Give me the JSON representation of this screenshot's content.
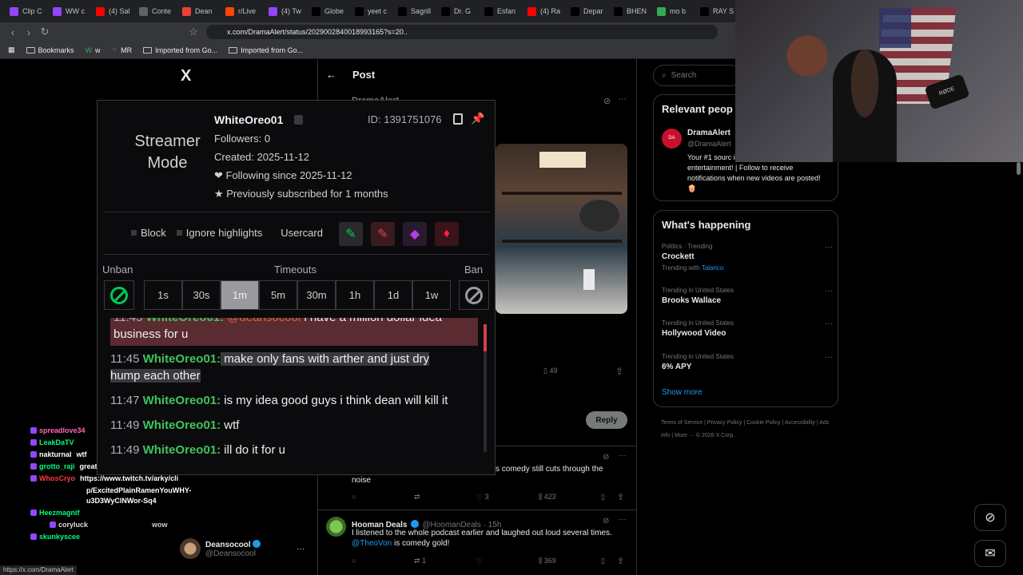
{
  "browser": {
    "tabs": [
      {
        "label": "Clip C",
        "color": "#9146ff"
      },
      {
        "label": "WW c",
        "color": "#9146ff"
      },
      {
        "label": "(4) Sal",
        "color": "#ff0000"
      },
      {
        "label": "Conte",
        "color": "#5f6368"
      },
      {
        "label": "Dean",
        "color": "#ea4335"
      },
      {
        "label": "r/Live",
        "color": "#ff4500"
      },
      {
        "label": "(4) Tw",
        "color": "#9146ff"
      },
      {
        "label": "Globe",
        "color": "#000000"
      },
      {
        "label": "yeet c",
        "color": "#000000"
      },
      {
        "label": "Sagrill",
        "color": "#000000"
      },
      {
        "label": "Dr. G",
        "color": "#000000"
      },
      {
        "label": "Esfan",
        "color": "#000000"
      },
      {
        "label": "(4) Ra",
        "color": "#ff0000"
      },
      {
        "label": "Depar",
        "color": "#000000"
      },
      {
        "label": "BHEN",
        "color": "#000000"
      },
      {
        "label": "mo b",
        "color": "#34a853"
      },
      {
        "label": "RAY S",
        "color": "#000000"
      }
    ],
    "url": "x.com/DramaAlert/status/2029002840018993165?s=20..",
    "bookmarks": [
      "Bookmarks",
      "w",
      "MR",
      "Imported from Go...",
      "Imported from Go..."
    ],
    "status_url": "https://x.com/DramaAlert"
  },
  "x": {
    "logo": "X",
    "post_header": "Post",
    "post_author_partial": "DramaAlert",
    "stats": {
      "bookmarks": "49"
    },
    "reply_button": "Reply",
    "tweet1": {
      "text_partial": "s comedy still cuts through the",
      "text_line2": "noise",
      "likes": "3",
      "views": "423"
    },
    "tweet2": {
      "name": "Hooman Deals",
      "handle": "@HoomanDeals · 15h",
      "text": "I listened to the whole podcast earlier and laughed out loud several times.",
      "mention": "@TheoVon",
      "text_end": "is comedy gold!",
      "retweets": "1",
      "views": "369"
    },
    "search_placeholder": "Search",
    "relevant": {
      "title": "Relevant peop",
      "name": "DramaAlert",
      "handle": "@DramaAlert",
      "bio": "Your #1 sourc interactions in online entertainment! | Follow to receive notifications when new videos are posted! 🍿"
    },
    "happening": {
      "title": "What's happening",
      "trends": [
        {
          "meta": "Politics · Trending",
          "name": "Crockett",
          "extra": "Trending with ",
          "extra_link": "Talarico"
        },
        {
          "meta": "Trending in United States",
          "name": "Brooks Wallace",
          "extra": "",
          "extra_link": ""
        },
        {
          "meta": "Trending in United States",
          "name": "Hollywood Video",
          "extra": "",
          "extra_link": ""
        },
        {
          "meta": "Trending in United States",
          "name": "6% APY",
          "extra": "",
          "extra_link": ""
        }
      ],
      "show_more": "Show more"
    },
    "footer": "Terms of Service | Privacy Policy | Cookie Policy | Accessibility | Ads info | More ··· © 2026 X Corp.",
    "deanso_name": "Deansocool",
    "deanso_handle": "@Deansocool"
  },
  "mod_popup": {
    "mode_label": "Streamer Mode",
    "username": "WhiteOreo01",
    "user_id": "ID: 1391751076",
    "followers": "Followers: 0",
    "created": "Created: 2025-11-12",
    "following": "❤ Following since 2025-11-12",
    "subscribed": "★ Previously subscribed for 1 months",
    "options": {
      "block": "Block",
      "ignore": "Ignore highlights",
      "usercard": "Usercard"
    },
    "labels": {
      "unban": "Unban",
      "timeouts": "Timeouts",
      "ban": "Ban"
    },
    "timeouts": [
      "1s",
      "30s",
      "1m",
      "5m",
      "30m",
      "1h",
      "1d",
      "1w"
    ],
    "active_timeout": "1m",
    "messages": [
      {
        "ts": "11:45",
        "who": "WhiteOreo01:",
        "mention": "@deansocool",
        "text": " i have a million dollar idea",
        "line2": "business for u"
      },
      {
        "ts": "11:45",
        "who": "WhiteOreo01:",
        "text": " make only fans with arther and just dry",
        "line2": "hump each other"
      },
      {
        "ts": "11:47",
        "who": "WhiteOreo01:",
        "text": " is my idea good guys i think dean will kill it"
      },
      {
        "ts": "11:49",
        "who": "WhiteOreo01:",
        "text": " wtf"
      },
      {
        "ts": "11:49",
        "who": "WhiteOreo01:",
        "text": " ill do it for u"
      }
    ]
  },
  "twitch_chat": [
    {
      "user": "spreadlove34",
      "color": "#ff69b4",
      "msg": ""
    },
    {
      "user": "LeakDaTV",
      "color": "#00ff7f",
      "msg": ""
    },
    {
      "user": "nakturnal",
      "color": "#ffffff",
      "msg": "wtf"
    },
    {
      "user": "grotto_raji",
      "color": "#00ff7f",
      "msg": "great idea"
    },
    {
      "user": "WhosCryo",
      "color": "#ff3b3b",
      "msg": "https://www.twitch.tv/arky/cli"
    },
    {
      "user": "",
      "color": "#ffffff",
      "msg": "p/ExcitedPlainRamenYouWHY-"
    },
    {
      "user": "",
      "color": "#ffffff",
      "msg": "u3D3WyClNWor-Sq4"
    },
    {
      "user": "Heezmagnif",
      "color": "#00ff7f",
      "msg": ""
    },
    {
      "user": "coryluck",
      "color": "#dddddd",
      "msg": "wow"
    },
    {
      "user": "skunkyscee",
      "color": "#00ff7f",
      "msg": ""
    }
  ],
  "webcam": {
    "mic_brand": "RØDE"
  }
}
